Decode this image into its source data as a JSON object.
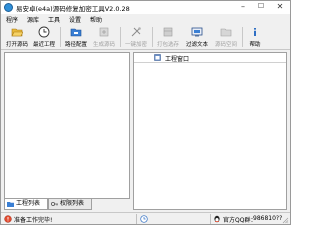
{
  "window": {
    "title": "易安卓(e4a)源码修复加密工具V2.0.28",
    "min_label": "–",
    "max_label": "☐",
    "close_label": "✕"
  },
  "menu": [
    "程序",
    "源库",
    "工具",
    "设置",
    "帮助"
  ],
  "toolbar": {
    "buttons": [
      {
        "label": "打开源码",
        "icon": "open-folder-icon",
        "enabled": true
      },
      {
        "label": "最近工程",
        "icon": "clock-icon",
        "enabled": true
      },
      {
        "label": "路径配置",
        "icon": "path-folder-icon",
        "enabled": true
      },
      {
        "label": "生成源码",
        "icon": "generate-icon",
        "enabled": false
      },
      {
        "label": "一键加密",
        "icon": "encrypt-icon",
        "enabled": false
      },
      {
        "label": "打包选存",
        "icon": "package-icon",
        "enabled": false
      },
      {
        "label": "过滤文本",
        "icon": "filter-icon",
        "enabled": true
      },
      {
        "label": "源码空间",
        "icon": "space-folder-icon",
        "enabled": false
      },
      {
        "label": "帮助",
        "icon": "info-icon",
        "enabled": true
      }
    ]
  },
  "left_panel": {
    "tabs": [
      {
        "label": "工程列表",
        "active": true
      },
      {
        "label": "权限列表",
        "active": false
      }
    ]
  },
  "right_panel": {
    "header": "工程窗口"
  },
  "status": {
    "message": "准备工作完毕!",
    "link_label": "官方QQ群：",
    "qq_group": "986810??"
  },
  "colors": {
    "accent": "#2f8fd8",
    "disabled_text": "#a0a0a0",
    "panel_border": "#a0a0a0"
  }
}
